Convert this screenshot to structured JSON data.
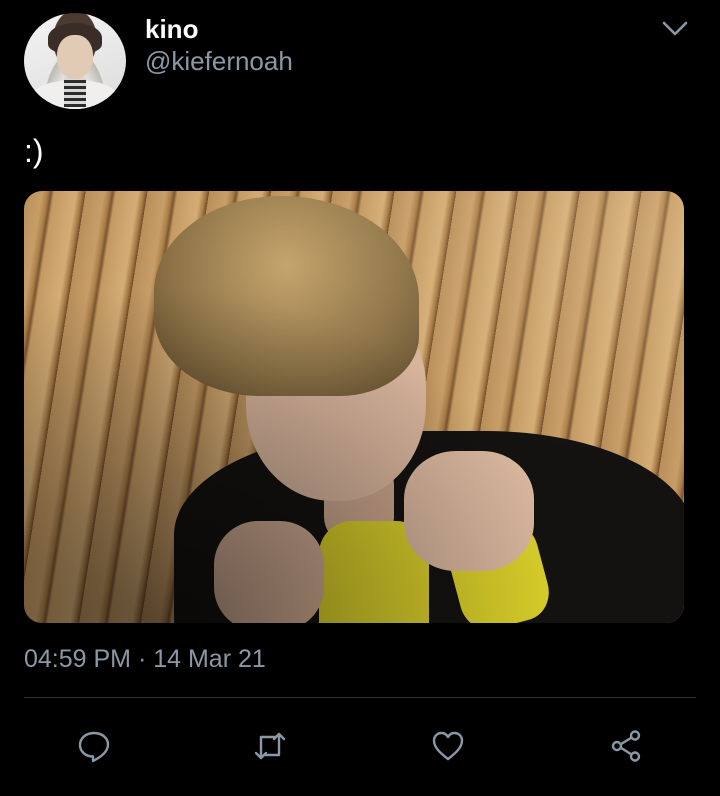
{
  "author": {
    "display_name": "kino",
    "handle": "@kiefernoah",
    "avatar_icon": "profile-photo"
  },
  "tweet": {
    "text": ":)",
    "media_icon": "photo",
    "timestamp": "04:59 PM · 14 Mar 21"
  },
  "actions": {
    "reply_icon": "reply-icon",
    "retweet_icon": "retweet-icon",
    "like_icon": "heart-icon",
    "share_icon": "share-icon"
  },
  "colors": {
    "background": "#000000",
    "text_primary": "#ffffff",
    "text_secondary": "#8b98a5",
    "icon": "#8b98a5",
    "divider": "#2f3336"
  }
}
